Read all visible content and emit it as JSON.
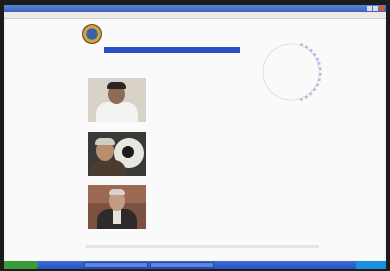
{
  "window": {
    "title": "",
    "controls": [
      "minimize",
      "maximize",
      "close"
    ]
  },
  "menu": {
    "items": [
      "",
      "",
      "",
      ""
    ]
  },
  "page": {
    "section_heading": "",
    "link_text": "",
    "photos": [
      "portrait-1",
      "portrait-2",
      "portrait-3"
    ]
  },
  "taskbar": {
    "start_label": "",
    "tasks": [
      "",
      ""
    ],
    "clock": ""
  },
  "colors": {
    "title_blue": "#3a63c0",
    "banner_blue": "#2a4fc8",
    "taskbar_blue": "#2452c0",
    "start_green": "#3b9b3b"
  }
}
